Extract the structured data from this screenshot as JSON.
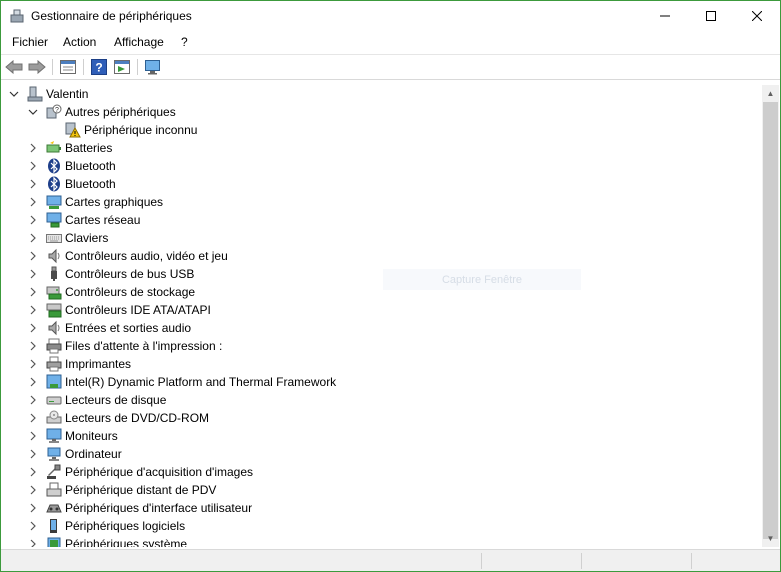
{
  "window": {
    "title": "Gestionnaire de périphériques",
    "controls": [
      "minimize",
      "maximize",
      "close"
    ]
  },
  "menu": [
    "Fichier",
    "Action",
    "Affichage",
    "?"
  ],
  "toolbar": {
    "buttons": [
      "back-arrow-icon",
      "forward-arrow-icon",
      "properties-icon",
      "help-icon",
      "view-icon",
      "monitor-scan-icon"
    ]
  },
  "tree": {
    "root": "Valentin",
    "categories": [
      {
        "label": "Autres périphériques",
        "expanded": true,
        "icon": "unknown-device-icon",
        "children": [
          {
            "label": "Périphérique inconnu",
            "icon": "warning-device-icon"
          }
        ]
      },
      {
        "label": "Batteries",
        "icon": "battery-icon"
      },
      {
        "label": "Bluetooth",
        "icon": "bluetooth-icon"
      },
      {
        "label": "Bluetooth",
        "icon": "bluetooth-icon"
      },
      {
        "label": "Cartes graphiques",
        "icon": "display-adapter-icon"
      },
      {
        "label": "Cartes réseau",
        "icon": "network-icon"
      },
      {
        "label": "Claviers",
        "icon": "keyboard-icon"
      },
      {
        "label": "Contrôleurs audio, vidéo et jeu",
        "icon": "speaker-icon"
      },
      {
        "label": "Contrôleurs de bus USB",
        "icon": "usb-icon"
      },
      {
        "label": "Contrôleurs de stockage",
        "icon": "storage-icon"
      },
      {
        "label": "Contrôleurs IDE ATA/ATAPI",
        "icon": "ide-icon"
      },
      {
        "label": "Entrées et sorties audio",
        "icon": "speaker-icon"
      },
      {
        "label": "Files d'attente à l'impression :",
        "icon": "print-queue-icon"
      },
      {
        "label": "Imprimantes",
        "icon": "printer-icon"
      },
      {
        "label": "Intel(R) Dynamic Platform and Thermal Framework",
        "icon": "chip-icon"
      },
      {
        "label": "Lecteurs de disque",
        "icon": "disk-icon"
      },
      {
        "label": "Lecteurs de DVD/CD-ROM",
        "icon": "dvd-icon"
      },
      {
        "label": "Moniteurs",
        "icon": "monitor-icon"
      },
      {
        "label": "Ordinateur",
        "icon": "computer-icon"
      },
      {
        "label": "Périphérique d'acquisition d'images",
        "icon": "camera-icon"
      },
      {
        "label": "Périphérique distant de PDV",
        "icon": "pos-icon"
      },
      {
        "label": "Périphériques d'interface utilisateur",
        "icon": "hid-icon"
      },
      {
        "label": "Périphériques logiciels",
        "icon": "software-device-icon"
      },
      {
        "label": "Périphériques système",
        "icon": "system-device-icon"
      }
    ]
  },
  "overlay_text": "Capture Fenêtre"
}
